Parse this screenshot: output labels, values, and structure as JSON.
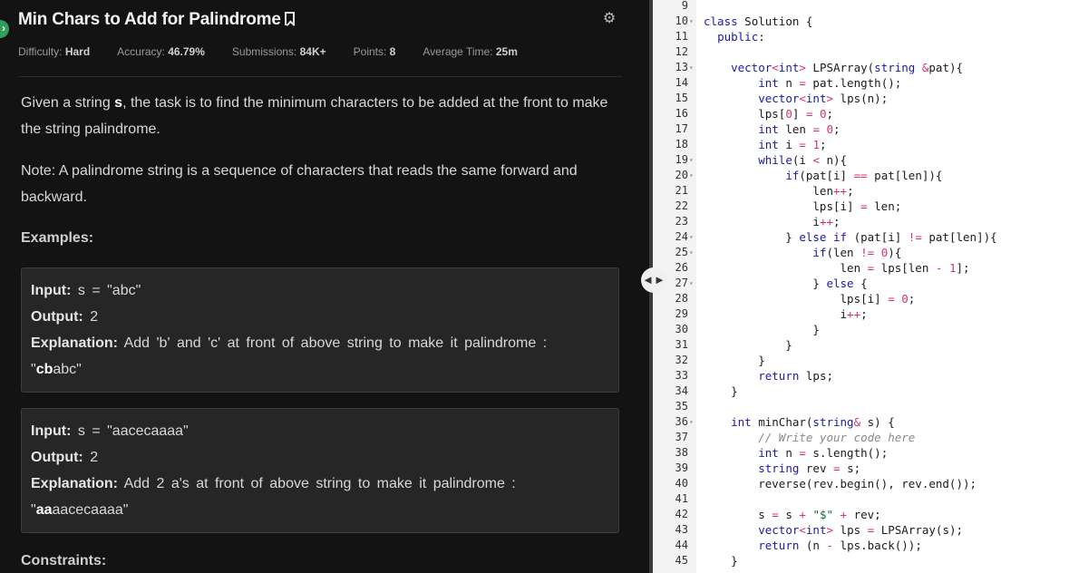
{
  "problem": {
    "title": "Min Chars to Add for Palindrome",
    "meta": [
      {
        "label": "Difficulty:",
        "value": "Hard"
      },
      {
        "label": "Accuracy:",
        "value": "46.79%"
      },
      {
        "label": "Submissions:",
        "value": "84K+"
      },
      {
        "label": "Points:",
        "value": "8"
      },
      {
        "label": "Average Time:",
        "value": "25m"
      }
    ],
    "desc_pre": "Given a string ",
    "desc_var": "s",
    "desc_post": ", the task is to find the minimum characters to be added at the front to make the string palindrome.",
    "note": "Note: A palindrome string is a sequence of characters that reads the same forward and backward.",
    "examples_heading": "Examples:",
    "examples": [
      {
        "input_label": "Input:",
        "input": "s = \"abc\"",
        "output_label": "Output:",
        "output": "2",
        "explanation_label": "Explanation:",
        "explanation": "Add 'b' and 'c' at front of above string to make it palindrome :",
        "result_bold": "cb",
        "result_rest": "abc"
      },
      {
        "input_label": "Input:",
        "input": "s = \"aacecaaaa\"",
        "output_label": "Output:",
        "output": "2",
        "explanation_label": "Explanation:",
        "explanation": "Add 2 a's at front of above string to make it palindrome :",
        "result_bold": "aa",
        "result_rest": "aacecaaaa"
      }
    ],
    "constraints_heading": "Constraints:"
  },
  "editor": {
    "lines": [
      {
        "n": "9",
        "fold": false,
        "code": ""
      },
      {
        "n": "10",
        "fold": true,
        "code": "class Solution {"
      },
      {
        "n": "11",
        "fold": false,
        "code": "  public:"
      },
      {
        "n": "12",
        "fold": false,
        "code": ""
      },
      {
        "n": "13",
        "fold": true,
        "code": "    vector<int> LPSArray(string &pat){"
      },
      {
        "n": "14",
        "fold": false,
        "code": "        int n = pat.length();"
      },
      {
        "n": "15",
        "fold": false,
        "code": "        vector<int> lps(n);"
      },
      {
        "n": "16",
        "fold": false,
        "code": "        lps[0] = 0;"
      },
      {
        "n": "17",
        "fold": false,
        "code": "        int len = 0;"
      },
      {
        "n": "18",
        "fold": false,
        "code": "        int i = 1;"
      },
      {
        "n": "19",
        "fold": true,
        "code": "        while(i < n){"
      },
      {
        "n": "20",
        "fold": true,
        "code": "            if(pat[i] == pat[len]){"
      },
      {
        "n": "21",
        "fold": false,
        "code": "                len++;"
      },
      {
        "n": "22",
        "fold": false,
        "code": "                lps[i] = len;"
      },
      {
        "n": "23",
        "fold": false,
        "code": "                i++;"
      },
      {
        "n": "24",
        "fold": true,
        "code": "            } else if (pat[i] != pat[len]){"
      },
      {
        "n": "25",
        "fold": true,
        "code": "                if(len != 0){"
      },
      {
        "n": "26",
        "fold": false,
        "code": "                    len = lps[len - 1];"
      },
      {
        "n": "27",
        "fold": true,
        "code": "                } else {"
      },
      {
        "n": "28",
        "fold": false,
        "code": "                    lps[i] = 0;"
      },
      {
        "n": "29",
        "fold": false,
        "code": "                    i++;"
      },
      {
        "n": "30",
        "fold": false,
        "code": "                }"
      },
      {
        "n": "31",
        "fold": false,
        "code": "            }"
      },
      {
        "n": "32",
        "fold": false,
        "code": "        }"
      },
      {
        "n": "33",
        "fold": false,
        "code": "        return lps;"
      },
      {
        "n": "34",
        "fold": false,
        "code": "    }"
      },
      {
        "n": "35",
        "fold": false,
        "code": ""
      },
      {
        "n": "36",
        "fold": true,
        "code": "    int minChar(string& s) {"
      },
      {
        "n": "37",
        "fold": false,
        "code": "        // Write your code here"
      },
      {
        "n": "38",
        "fold": false,
        "code": "        int n = s.length();"
      },
      {
        "n": "39",
        "fold": false,
        "code": "        string rev = s;"
      },
      {
        "n": "40",
        "fold": false,
        "code": "        reverse(rev.begin(), rev.end());"
      },
      {
        "n": "41",
        "fold": false,
        "code": ""
      },
      {
        "n": "42",
        "fold": false,
        "code": "        s = s + \"$\" + rev;"
      },
      {
        "n": "43",
        "fold": false,
        "code": "        vector<int> lps = LPSArray(s);"
      },
      {
        "n": "44",
        "fold": false,
        "code": "        return (n - lps.back());"
      },
      {
        "n": "45",
        "fold": false,
        "code": "    }"
      }
    ]
  }
}
